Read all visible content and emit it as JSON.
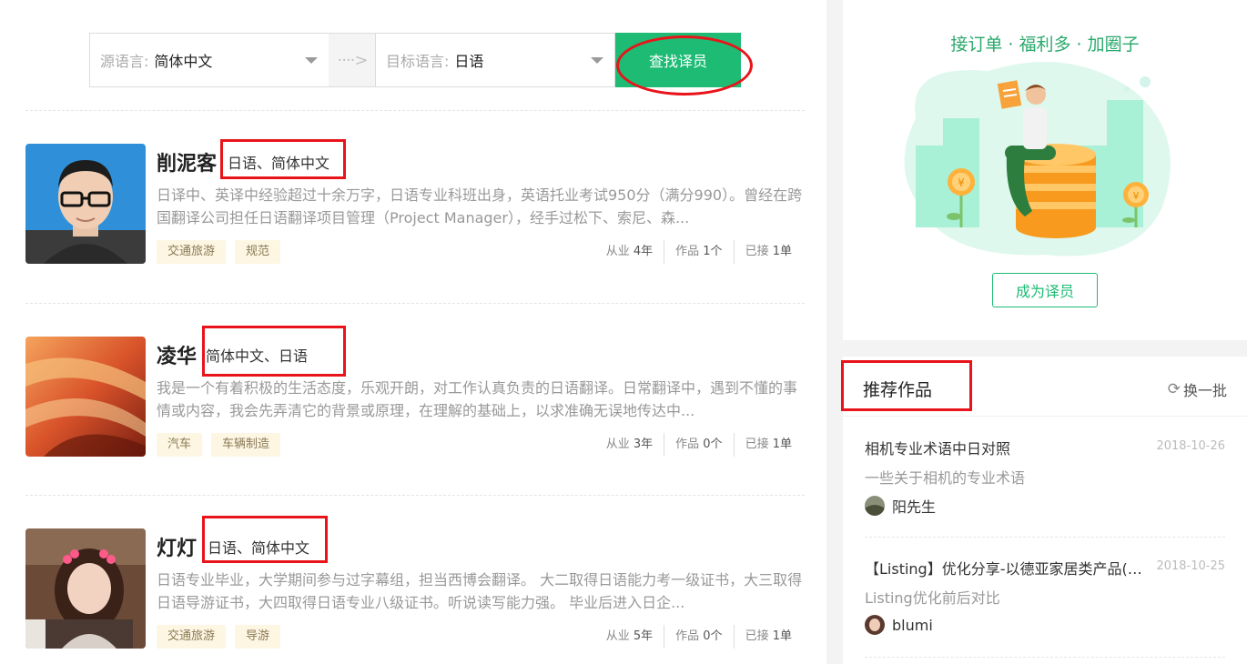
{
  "search": {
    "source_label": "源语言:",
    "source_value": "简体中文",
    "arrow": "····>",
    "target_label": "目标语言:",
    "target_value": "日语",
    "button": "查找译员"
  },
  "translators": [
    {
      "name": "削泥客",
      "langs": "日语、简体中文",
      "desc": "日译中、英译中经验超过十余万字，日语专业科班出身，英语托业考试950分（满分990）。曾经在跨国翻译公司担任日语翻译项目管理（Project Manager），经手过松下、索尼、森...",
      "tags": [
        "交通旅游",
        "规范"
      ],
      "years_label": "从业",
      "years": "4年",
      "works_label": "作品",
      "works": "1个",
      "orders_label": "已接",
      "orders": "1单"
    },
    {
      "name": "凌华",
      "langs": "简体中文、日语",
      "desc": "我是一个有着积极的生活态度，乐观开朗，对工作认真负责的日语翻译。日常翻译中，遇到不懂的事情或内容，我会先弄清它的背景或原理，在理解的基础上，以求准确无误地传达中...",
      "tags": [
        "汽车",
        "车辆制造"
      ],
      "years_label": "从业",
      "years": "3年",
      "works_label": "作品",
      "works": "0个",
      "orders_label": "已接",
      "orders": "1单"
    },
    {
      "name": "灯灯",
      "langs": "日语、简体中文",
      "desc": "日语专业毕业，大学期间参与过字幕组，担当西博会翻译。 大二取得日语能力考一级证书，大三取得日语导游证书，大四取得日语专业八级证书。听说读写能力强。 毕业后进入日企...",
      "tags": [
        "交通旅游",
        "导游"
      ],
      "years_label": "从业",
      "years": "5年",
      "works_label": "作品",
      "works": "0个",
      "orders_label": "已接",
      "orders": "1单"
    }
  ],
  "promo": {
    "title": "接订单 · 福利多 · 加圈子",
    "button": "成为译员"
  },
  "recommend": {
    "title": "推荐作品",
    "refresh": "换一批",
    "works": [
      {
        "title": "相机专业术语中日对照",
        "date": "2018-10-26",
        "sub": "一些关于相机的专业术语",
        "user": "阳先生"
      },
      {
        "title": "【Listing】优化分享-以德亚家居类产品(…",
        "date": "2018-10-25",
        "sub": "Listing优化前后对比",
        "user": "blumi"
      }
    ]
  },
  "colors": {
    "accent": "#1dbb74",
    "annotation": "#e8141a"
  }
}
